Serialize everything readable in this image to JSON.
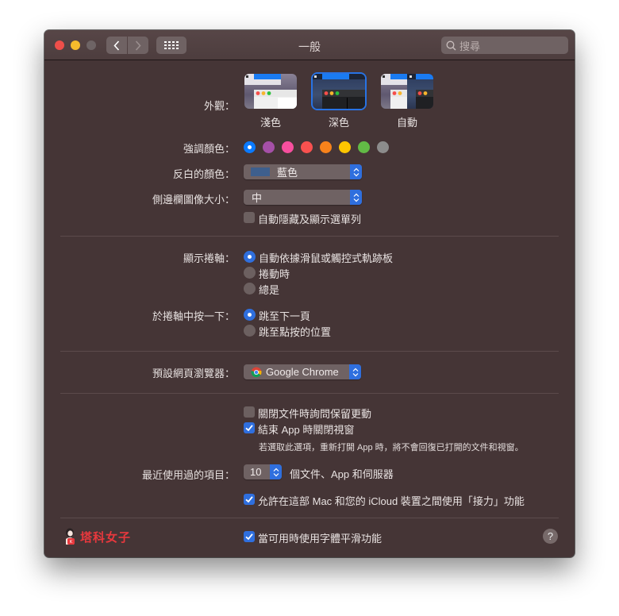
{
  "window": {
    "title": "一般",
    "search_placeholder": "搜尋"
  },
  "appearance": {
    "label": "外觀：",
    "options": [
      {
        "label": "淺色",
        "selected": false
      },
      {
        "label": "深色",
        "selected": true
      },
      {
        "label": "自動",
        "selected": false
      }
    ]
  },
  "accent_color": {
    "label": "強調顏色：",
    "colors": [
      "#0a7aff",
      "#a550a7",
      "#f74f9e",
      "#f9514f",
      "#f7821b",
      "#ffc600",
      "#62ba46",
      "#8c8c8c"
    ],
    "names": [
      "blue",
      "purple",
      "pink",
      "red",
      "orange",
      "yellow",
      "green",
      "graphite"
    ],
    "selected_index": 0
  },
  "highlight_color": {
    "label": "反白的顏色：",
    "value": "藍色",
    "swatch": "#3e5f8d"
  },
  "sidebar_icon_size": {
    "label": "側邊欄圖像大小：",
    "value": "中"
  },
  "auto_hide_menubar": {
    "label": "自動隱藏及顯示選單列",
    "checked": false
  },
  "show_scrollbars": {
    "label": "顯示捲軸：",
    "options": [
      {
        "label": "自動依據滑鼠或觸控式軌跡板",
        "selected": true
      },
      {
        "label": "捲動時",
        "selected": false
      },
      {
        "label": "總是",
        "selected": false
      }
    ]
  },
  "click_scrollbar": {
    "label": "於捲軸中按一下：",
    "options": [
      {
        "label": "跳至下一頁",
        "selected": true
      },
      {
        "label": "跳至點按的位置",
        "selected": false
      }
    ]
  },
  "default_browser": {
    "label": "預設網頁瀏覽器：",
    "value": "Google Chrome"
  },
  "ask_keep_changes": {
    "label": "關閉文件時詢問保留更動",
    "checked": false
  },
  "close_windows": {
    "label": "結束 App 時關閉視窗",
    "checked": true,
    "note": "若選取此選項，重新打開 App 時，將不會回復已打開的文件和視窗。"
  },
  "recent_items": {
    "label": "最近使用過的項目：",
    "value": "10",
    "suffix": "個文件、App 和伺服器"
  },
  "handoff": {
    "label": "允許在這部 Mac 和您的 iCloud 裝置之間使用「接力」功能",
    "checked": true
  },
  "font_smoothing": {
    "label": "當可用時使用字體平滑功能",
    "checked": true
  },
  "watermark": {
    "text": "塔科女子"
  },
  "help": {
    "label": "?"
  },
  "accent": "#2f6fde"
}
